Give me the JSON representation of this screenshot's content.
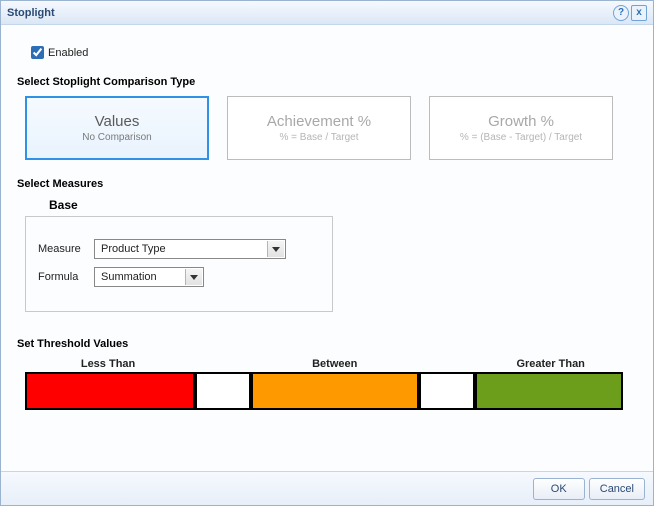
{
  "window": {
    "title": "Stoplight"
  },
  "enabled": {
    "label": "Enabled",
    "checked": true
  },
  "sections": {
    "comparison_label": "Select Stoplight Comparison Type",
    "measures_label": "Select Measures",
    "threshold_label": "Set Threshold Values"
  },
  "cards": {
    "values": {
      "title": "Values",
      "sub": "No Comparison",
      "selected": true
    },
    "achievement": {
      "title": "Achievement %",
      "sub": "% = Base / Target",
      "selected": false
    },
    "growth": {
      "title": "Growth %",
      "sub": "% = (Base - Target) / Target",
      "selected": false
    }
  },
  "measures": {
    "base_label": "Base",
    "measure_label": "Measure",
    "measure_value": "Product Type",
    "formula_label": "Formula",
    "formula_value": "Summation"
  },
  "threshold": {
    "less_label": "Less Than",
    "between_label": "Between",
    "greater_label": "Greater Than",
    "colors": {
      "less": "#ff0000",
      "between": "#ff9900",
      "greater": "#6c9e1b"
    },
    "low_input": "",
    "high_input": ""
  },
  "buttons": {
    "ok": "OK",
    "cancel": "Cancel"
  }
}
